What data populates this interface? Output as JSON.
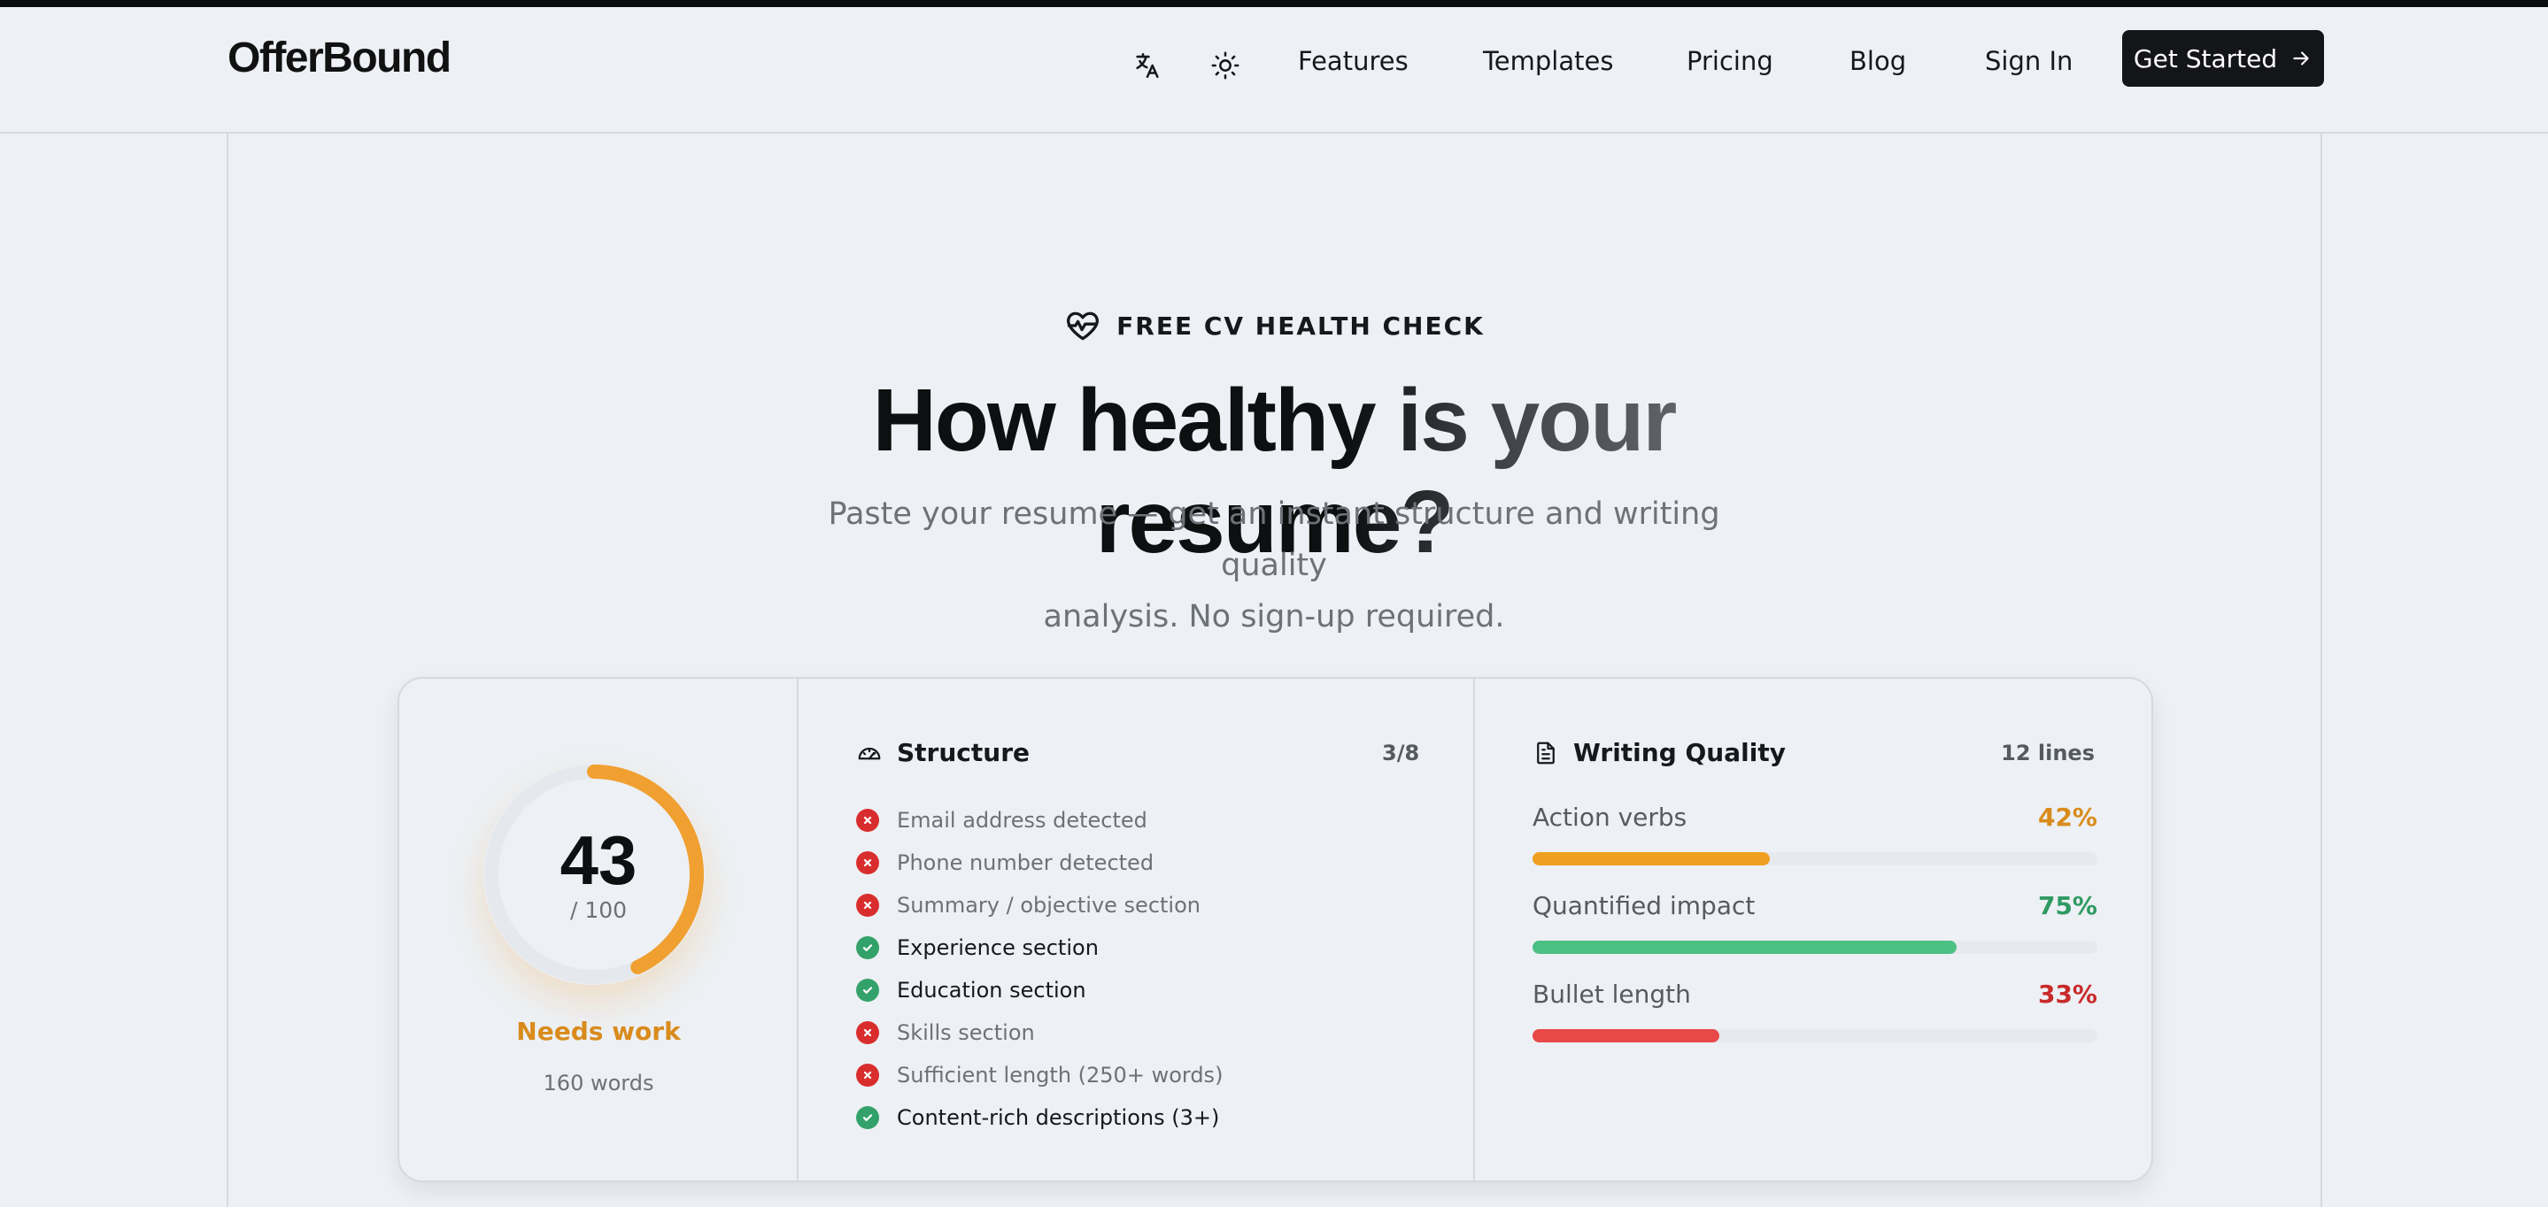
{
  "header": {
    "logo": "OfferBound",
    "icons": [
      "translate-icon",
      "sun-icon"
    ],
    "nav": [
      "Features",
      "Templates",
      "Pricing",
      "Blog",
      "Sign In"
    ],
    "cta_label": "Get Started",
    "cta_icon": "arrow-right-icon"
  },
  "hero": {
    "eyebrow_icon": "heart-pulse-icon",
    "eyebrow": "FREE CV HEALTH CHECK",
    "title": "How healthy is your resume?",
    "subtitle_line1": "Paste your resume — get an instant structure and writing quality",
    "subtitle_line2": "analysis. No sign-up required."
  },
  "score": {
    "value": "43",
    "denominator": "/ 100",
    "fraction": 0.43,
    "label": "Needs work",
    "words": "160 words",
    "color": "#f0a030"
  },
  "structure": {
    "icon": "gauge-icon",
    "title": "Structure",
    "count": "3/8",
    "items": [
      {
        "label": "Email address detected",
        "ok": false
      },
      {
        "label": "Phone number detected",
        "ok": false
      },
      {
        "label": "Summary / objective section",
        "ok": false
      },
      {
        "label": "Experience section",
        "ok": true
      },
      {
        "label": "Education section",
        "ok": true
      },
      {
        "label": "Skills section",
        "ok": false
      },
      {
        "label": "Sufficient length (250+ words)",
        "ok": false
      },
      {
        "label": "Content-rich descriptions (3+)",
        "ok": true
      }
    ]
  },
  "writing": {
    "icon": "document-icon",
    "title": "Writing Quality",
    "lines": "12 lines",
    "metrics": [
      {
        "label": "Action verbs",
        "value": "42%",
        "fraction": 0.42,
        "color": "#f0a020",
        "text_color": "#d98b1c"
      },
      {
        "label": "Quantified impact",
        "value": "75%",
        "fraction": 0.75,
        "color": "#4cbf82",
        "text_color": "#2f9a62"
      },
      {
        "label": "Bullet length",
        "value": "33%",
        "fraction": 0.33,
        "color": "#e84848",
        "text_color": "#c92a2a"
      }
    ]
  },
  "colors": {
    "good": "#33a26a",
    "bad": "#d92d2d",
    "accent": "#141518"
  }
}
